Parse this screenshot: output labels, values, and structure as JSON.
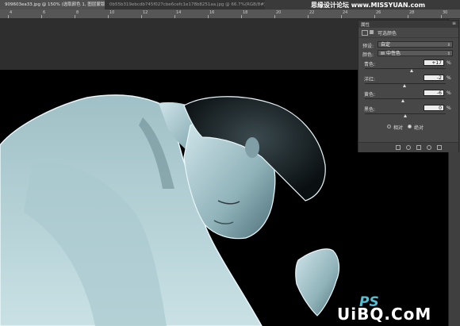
{
  "tabs": [
    {
      "label": "909603ea33.jpg @ 150% (选取颜色 1, 图层蒙版/8) *"
    },
    {
      "label": "0b55b319ebcdb745f027cbe6cefc1e178b8251aa.jpg @ 66.7%(RGB/8#) *"
    }
  ],
  "ruler": {
    "ticks": [
      "4",
      "6",
      "8",
      "10",
      "12",
      "14",
      "16",
      "18",
      "20",
      "22",
      "24",
      "26",
      "28",
      "30"
    ]
  },
  "watermark": {
    "site": "思缘设计论坛 www.MISSYUAN.com",
    "bottom_ps": "PS",
    "bottom_text": "UiBQ.CoM"
  },
  "panel": {
    "title": "属性",
    "menu": "≡",
    "sub_label": "可选颜色",
    "preset_label": "预设:",
    "preset_value": "自定",
    "color_label": "颜色:",
    "color_value": "中性色",
    "sliders": [
      {
        "label": "青色:",
        "value": "+17",
        "unit": "%",
        "level": 0.58
      },
      {
        "label": "洋红:",
        "value": "-2",
        "unit": "%",
        "level": 0.49
      },
      {
        "label": "黄色:",
        "value": "-6",
        "unit": "%",
        "level": 0.47
      },
      {
        "label": "黑色:",
        "value": "0",
        "unit": "%",
        "level": 0.5
      }
    ],
    "radio_relative": "相对",
    "radio_absolute": "绝对",
    "selected_mode": "absolute"
  },
  "colors": {
    "panel_bg": "#474747",
    "canvas_bg": "#000000",
    "ps_accent": "#4fc0d6"
  }
}
